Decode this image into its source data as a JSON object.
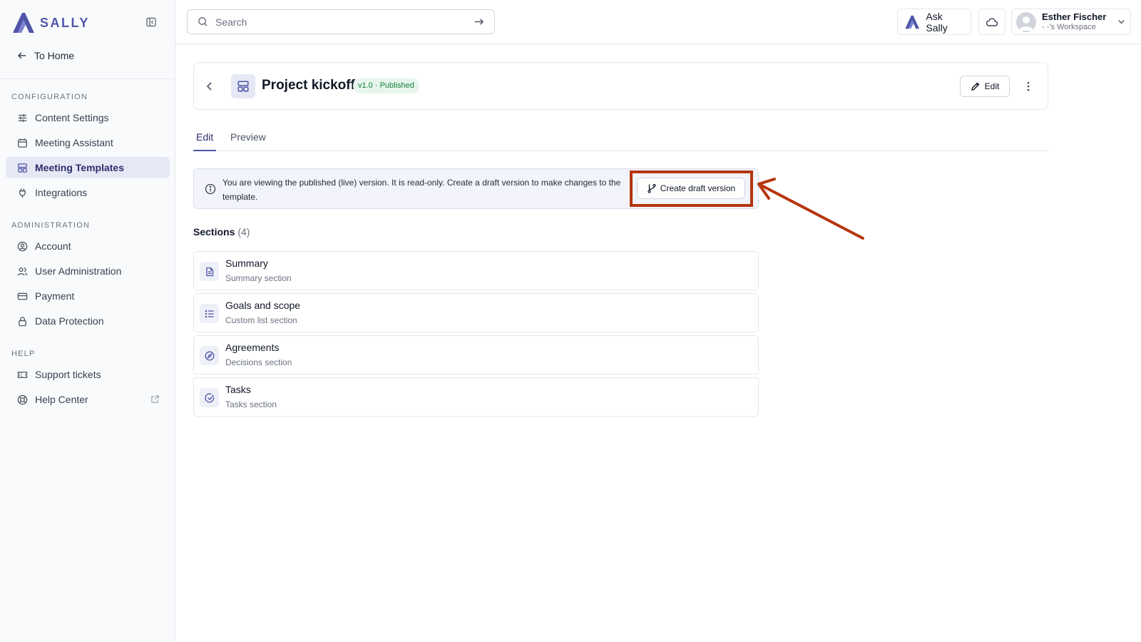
{
  "app": {
    "brand": "SALLY",
    "accent": "#4f55a8"
  },
  "sidebar": {
    "back_label": "To Home",
    "groups": [
      {
        "heading": "CONFIGURATION",
        "items": [
          {
            "label": "Content Settings",
            "icon": "sliders-icon"
          },
          {
            "label": "Meeting Assistant",
            "icon": "calendar-icon"
          },
          {
            "label": "Meeting Templates",
            "icon": "layout-template-icon",
            "active": true
          },
          {
            "label": "Integrations",
            "icon": "plug-icon"
          }
        ]
      },
      {
        "heading": "ADMINISTRATION",
        "items": [
          {
            "label": "Account",
            "icon": "user-circle-icon"
          },
          {
            "label": "User Administration",
            "icon": "users-icon"
          },
          {
            "label": "Payment",
            "icon": "credit-card-icon"
          },
          {
            "label": "Data Protection",
            "icon": "lock-icon"
          }
        ]
      },
      {
        "heading": "HELP",
        "items": [
          {
            "label": "Support tickets",
            "icon": "ticket-icon"
          },
          {
            "label": "Help Center",
            "icon": "life-buoy-icon",
            "external": true
          }
        ]
      }
    ]
  },
  "topbar": {
    "search_placeholder": "Search",
    "ask_label": "Ask Sally",
    "user": {
      "name": "Esther Fischer",
      "workspace": "- -'s Workspace"
    }
  },
  "header": {
    "title": "Project kickoff",
    "badge": "v1.0 · Published",
    "edit_label": "Edit"
  },
  "tabs": [
    {
      "label": "Edit",
      "active": true
    },
    {
      "label": "Preview",
      "active": false
    }
  ],
  "notice": {
    "text": "You are viewing the published (live) version. It is read-only. Create a draft version to make changes to the template.",
    "button_label": "Create draft version"
  },
  "sections": {
    "title": "Sections",
    "count": "(4)",
    "items": [
      {
        "title": "Summary",
        "subtitle": "Summary section",
        "icon": "file-text-icon"
      },
      {
        "title": "Goals and scope",
        "subtitle": "Custom list section",
        "icon": "list-icon"
      },
      {
        "title": "Agreements",
        "subtitle": "Decisions section",
        "icon": "compass-icon"
      },
      {
        "title": "Tasks",
        "subtitle": "Tasks section",
        "icon": "check-circle-icon"
      }
    ]
  },
  "annotation_color": "#b5360f"
}
